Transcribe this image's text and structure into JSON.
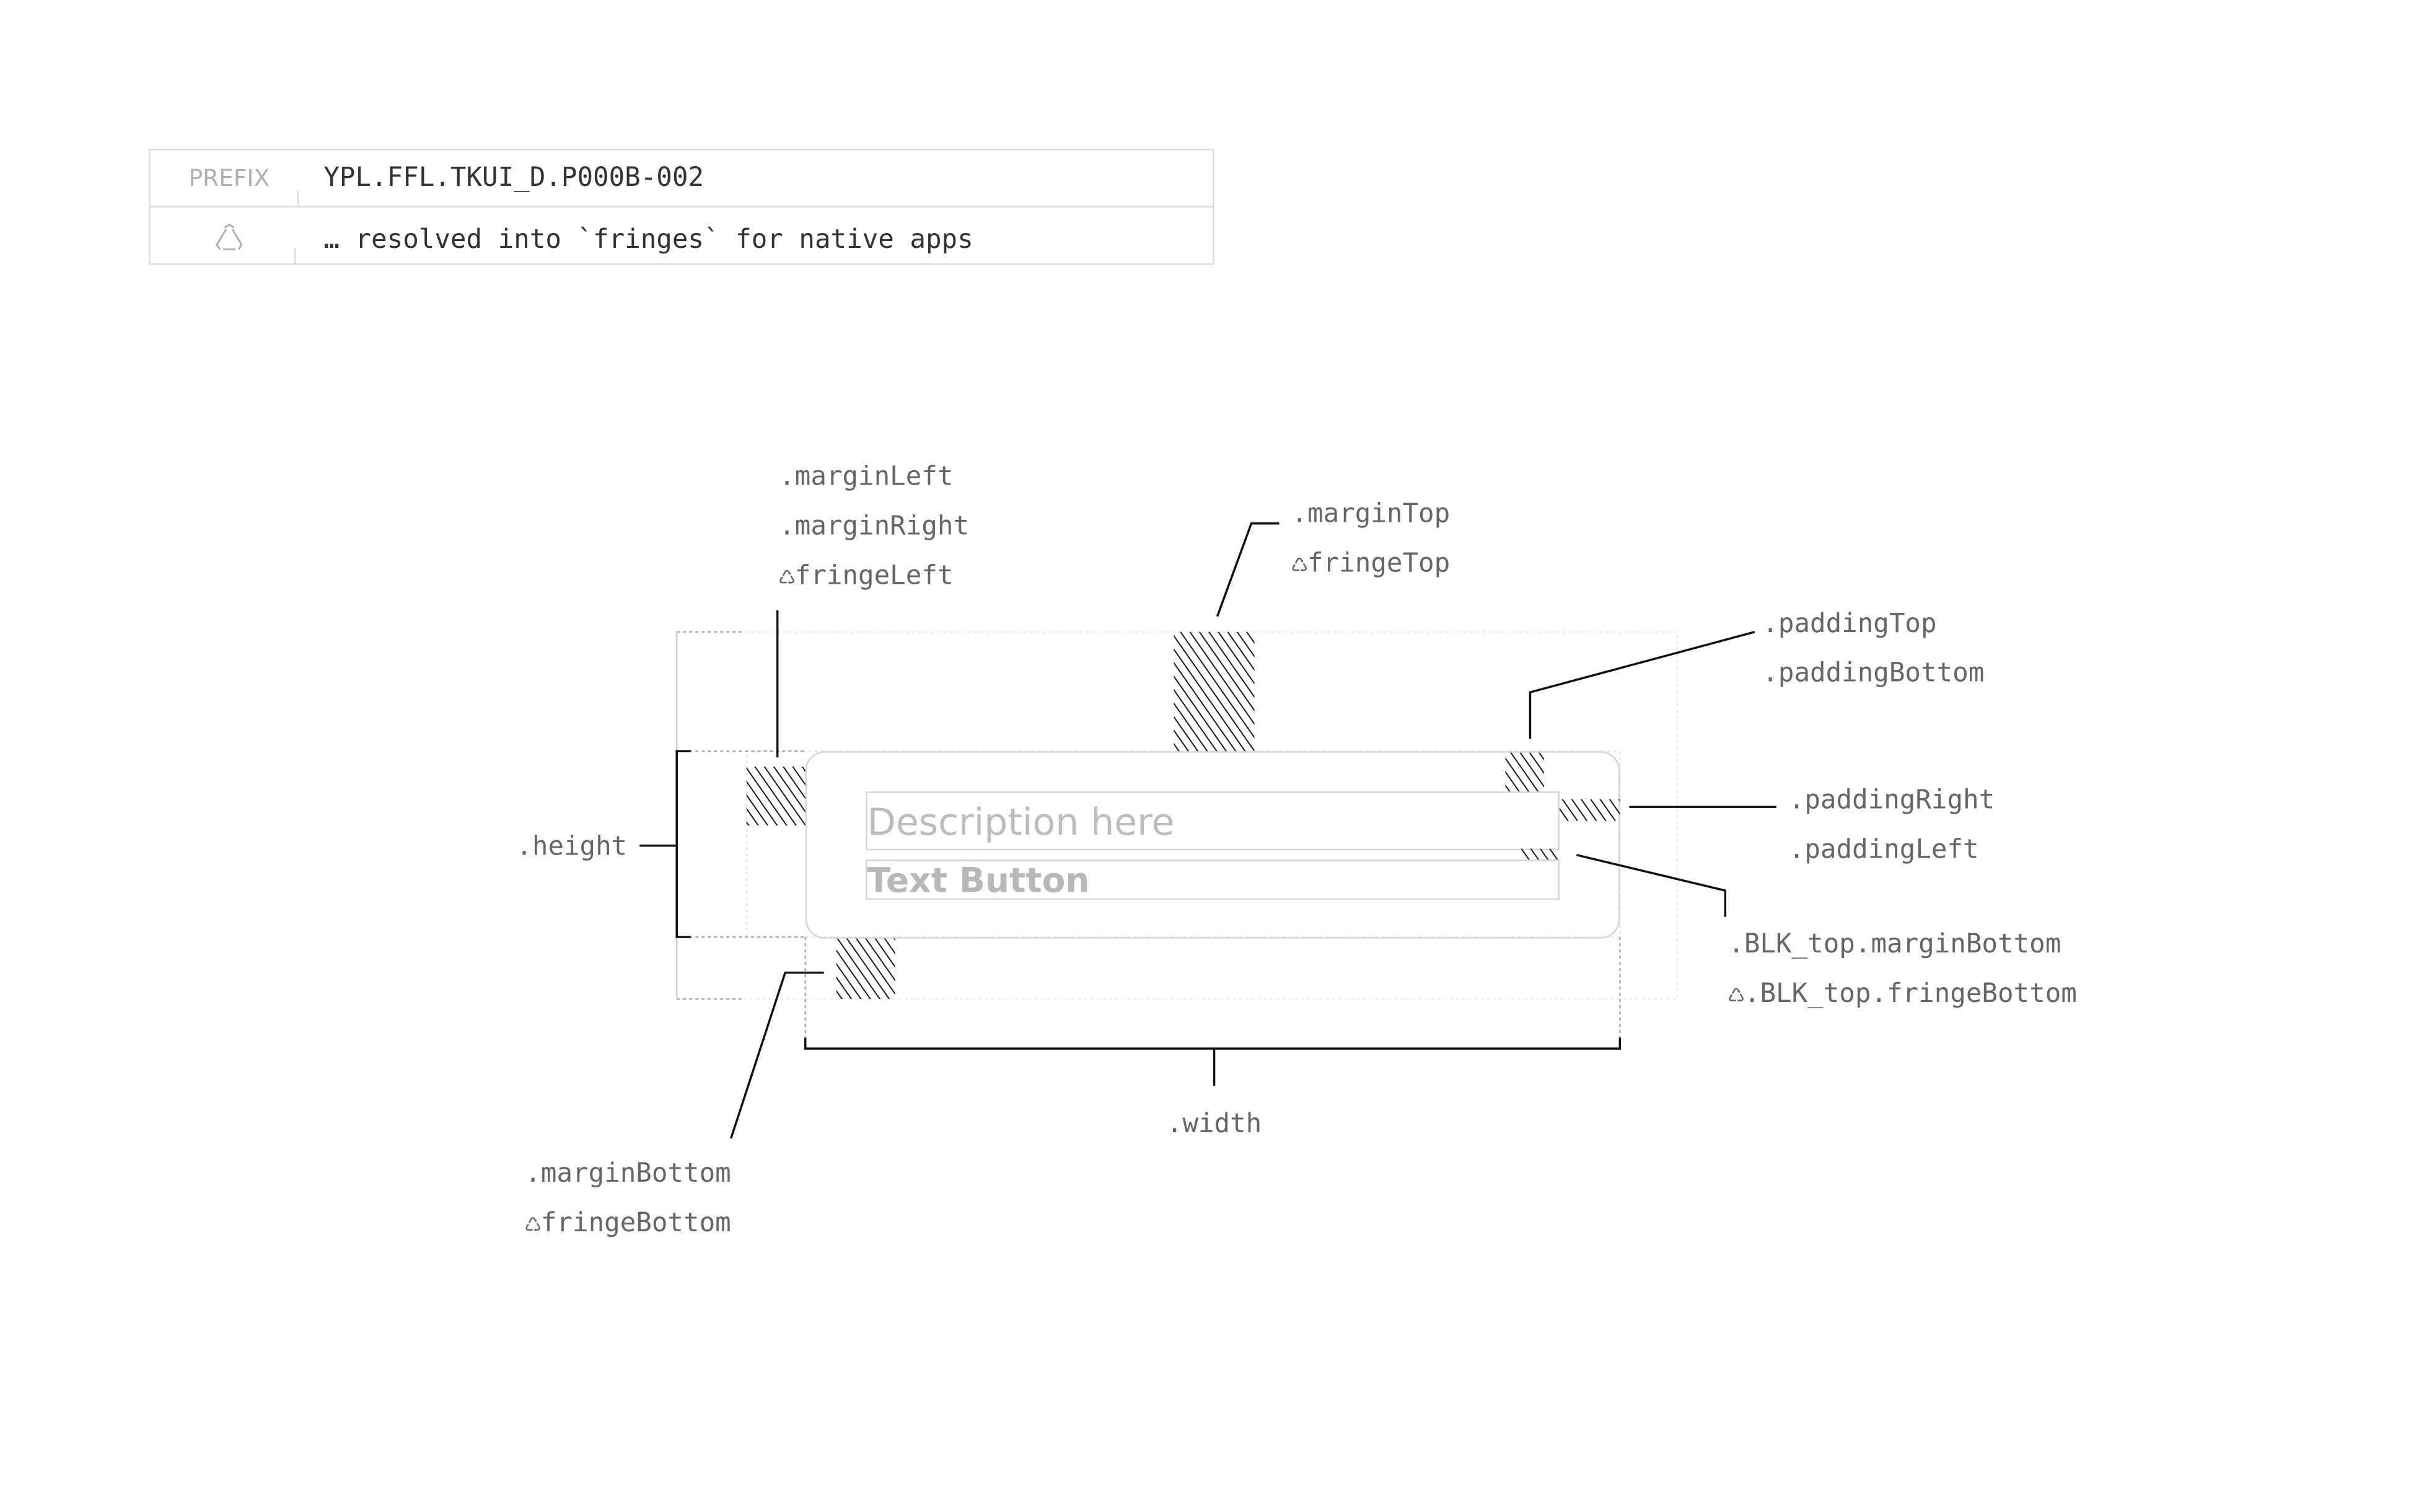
{
  "header_table": {
    "prefix_label": "PREFIX",
    "prefix_value": "YPL.FFL.TKUI_D.P000B-002",
    "note_icon": "recycle-outline-icon",
    "note_text": "… resolved into `fringes` for native apps"
  },
  "diagram": {
    "component": {
      "description": "Description here",
      "button_label": "Text Button"
    },
    "labels": {
      "margin_left": ".marginLeft",
      "margin_right": ".marginRight",
      "fringe_left": "♺fringeLeft",
      "margin_top": ".marginTop",
      "fringe_top": "♺fringeTop",
      "padding_top": ".paddingTop",
      "padding_bottom": ".paddingBottom",
      "padding_right": ".paddingRight",
      "padding_left": ".paddingLeft",
      "blk_margin_bottom": ".BLK_top.marginBottom",
      "blk_fringe_bottom": "♺.BLK_top.fringeBottom",
      "height": ".height",
      "width": ".width",
      "margin_bottom": ".marginBottom",
      "fringe_bottom": "♺fringeBottom"
    },
    "colors": {
      "label_text": "#666666",
      "line": "#000000",
      "outline": "#d6d6d6",
      "placeholder": "#b3b3b3"
    }
  }
}
